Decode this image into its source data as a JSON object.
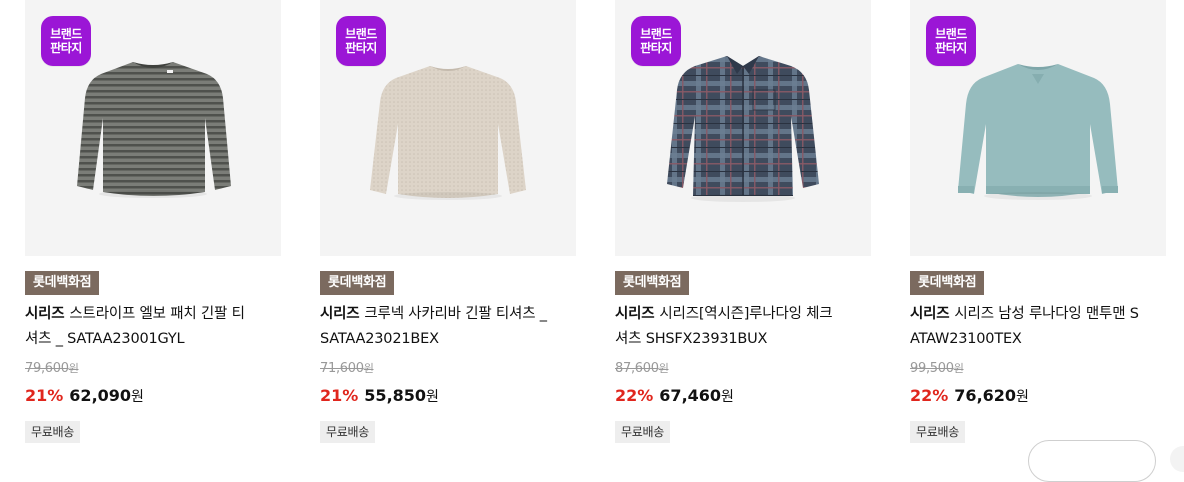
{
  "products": [
    {
      "badge": [
        "브랜드",
        "판타지"
      ],
      "store": "롯데백화점",
      "brand": "시리즈",
      "name_line1": "스트라이프 엘보 패치 긴팔 티",
      "name_line2": "셔츠 _ SATAA23001GYL",
      "original_price": "79,600",
      "original_unit": "원",
      "discount": "21%",
      "sale_price": "62,090",
      "sale_unit": "원",
      "shipping": "무료배송",
      "image": "gray-striped-sweater-icon",
      "color": "#6c6e6a"
    },
    {
      "badge": [
        "브랜드",
        "판타지"
      ],
      "store": "롯데백화점",
      "brand": "시리즈",
      "name_line1": "크루넥 사카리바 긴팔 티셔츠 _",
      "name_line2": "SATAA23021BEX",
      "original_price": "71,600",
      "original_unit": "원",
      "discount": "21%",
      "sale_price": "55,850",
      "sale_unit": "원",
      "shipping": "무료배송",
      "image": "beige-knit-sweater-icon",
      "color": "#d8cfc3"
    },
    {
      "badge": [
        "브랜드",
        "판타지"
      ],
      "store": "롯데백화점",
      "brand": "시리즈",
      "name_line1": "시리즈[역시즌]루나다잉 체크",
      "name_line2": "셔츠 SHSFX23931BUX",
      "original_price": "87,600",
      "original_unit": "원",
      "discount": "22%",
      "sale_price": "67,460",
      "sale_unit": "원",
      "shipping": "무료배송",
      "image": "navy-check-shirt-icon",
      "color": "#4a5668"
    },
    {
      "badge": [
        "브랜드",
        "판타지"
      ],
      "store": "롯데백화점",
      "brand": "시리즈",
      "name_line1": "시리즈 남성 루나다잉 맨투맨 S",
      "name_line2": "ATAW23100TEX",
      "original_price": "99,500",
      "original_unit": "원",
      "discount": "22%",
      "sale_price": "76,620",
      "sale_unit": "원",
      "shipping": "무료배송",
      "image": "mint-sweatshirt-icon",
      "color": "#93b9bb"
    }
  ],
  "colors": {
    "badge": "#9b16d6",
    "store_tag": "#7b6a5f",
    "discount": "#e0261d"
  }
}
